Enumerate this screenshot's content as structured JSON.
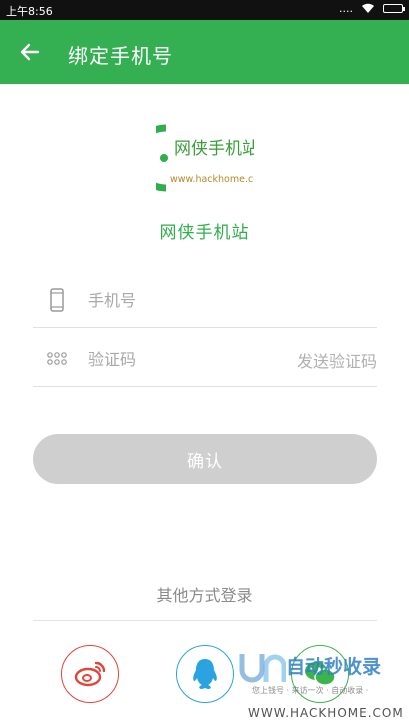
{
  "status_bar": {
    "time": "上午8:56",
    "signal": "....",
    "battery_icon": "battery-icon",
    "wifi_icon": "wifi-icon"
  },
  "app_bar": {
    "title": "绑定手机号",
    "back_icon": "arrow-left-icon",
    "background": "#34b052"
  },
  "logo": {
    "text": "网侠手机站",
    "url_text": "www.hackhome.com"
  },
  "brand_name": "网侠手机站",
  "form": {
    "phone": {
      "placeholder": "手机号",
      "value": "",
      "icon": "phone-icon"
    },
    "code": {
      "placeholder": "验证码",
      "value": "",
      "icon": "dots-grid-icon"
    },
    "send_code_label": "发送验证码",
    "confirm_label": "确认"
  },
  "other_login": {
    "title": "其他方式登录",
    "providers": [
      {
        "name": "weibo",
        "icon": "weibo-icon",
        "color": "#e0463a"
      },
      {
        "name": "qq",
        "icon": "qq-penguin-icon",
        "color": "#2aa3e0"
      },
      {
        "name": "wechat",
        "icon": "wechat-icon",
        "color": "#3bb54a"
      }
    ]
  },
  "watermark": {
    "title": "自动秒收录",
    "subtitle": "您上钱号 · 来访一次 · 自动收录 ·",
    "url": "WWW.HACKHOME.COM"
  }
}
